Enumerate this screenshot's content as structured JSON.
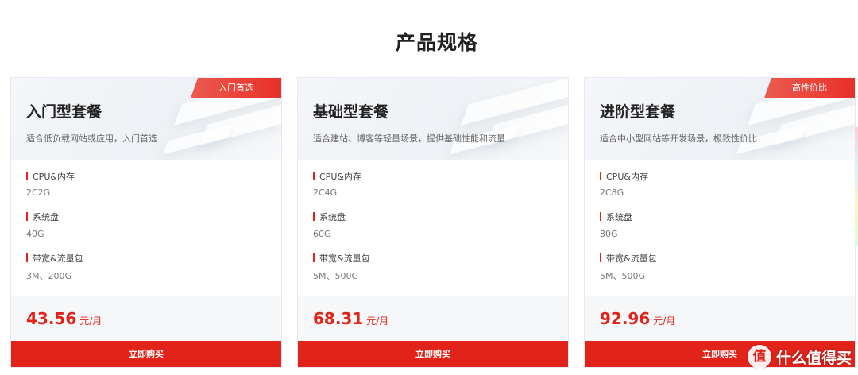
{
  "section": {
    "title": "产品规格"
  },
  "cards": [
    {
      "badge": "入门首选",
      "name": "入门型套餐",
      "desc": "适合低负载网站或应用，入门首选",
      "specs": [
        {
          "label": "CPU&内存",
          "value": "2C2G"
        },
        {
          "label": "系统盘",
          "value": "40G"
        },
        {
          "label": "带宽&流量包",
          "value": "3M、200G"
        }
      ],
      "price": "43.56",
      "unit": "元/月",
      "buy": "立即购买"
    },
    {
      "badge": "",
      "name": "基础型套餐",
      "desc": "适合建站、博客等轻量场景，提供基础性能和流量",
      "specs": [
        {
          "label": "CPU&内存",
          "value": "2C4G"
        },
        {
          "label": "系统盘",
          "value": "60G"
        },
        {
          "label": "带宽&流量包",
          "value": "5M、500G"
        }
      ],
      "price": "68.31",
      "unit": "元/月",
      "buy": "立即购买"
    },
    {
      "badge": "高性价比",
      "name": "进阶型套餐",
      "desc": "适合中小型网站等开发场景，极致性价比",
      "specs": [
        {
          "label": "CPU&内存",
          "value": "2C8G"
        },
        {
          "label": "系统盘",
          "value": "80G"
        },
        {
          "label": "带宽&流量包",
          "value": "5M、500G"
        }
      ],
      "price": "92.96",
      "unit": "元/月",
      "buy": "立即购买"
    }
  ],
  "watermark": {
    "logo": "值",
    "text": "什么值得买"
  },
  "colors": {
    "accent": "#e2231a",
    "badge_start": "#ea5b4f",
    "card_head_bg": "#f4f6f9"
  }
}
